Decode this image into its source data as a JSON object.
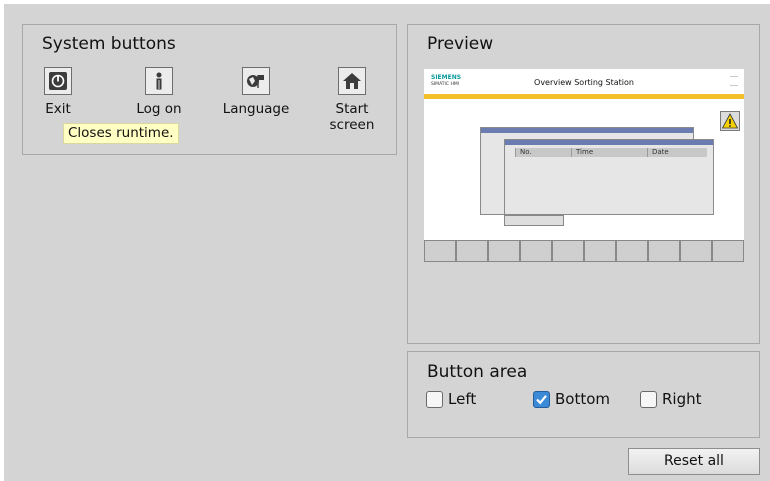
{
  "system_buttons": {
    "title": "System buttons",
    "items": [
      {
        "label": "Exit",
        "icon": "exit-icon"
      },
      {
        "label": "Log on",
        "icon": "user-icon"
      },
      {
        "label": "Language",
        "icon": "language-icon"
      },
      {
        "label": "Start screen",
        "icon": "home-icon"
      }
    ],
    "tooltip": "Closes runtime."
  },
  "preview": {
    "title": "Preview",
    "brand": "SIEMENS",
    "product": "SIMATIC HMI",
    "screen_title": "Overview Sorting Station",
    "columns": [
      "No.",
      "Time",
      "Date"
    ],
    "accent_color": "#f3c02c"
  },
  "button_area": {
    "title": "Button area",
    "options": [
      {
        "label": "Left",
        "checked": false
      },
      {
        "label": "Bottom",
        "checked": true
      },
      {
        "label": "Right",
        "checked": false
      }
    ]
  },
  "reset_label": "Reset all",
  "colors": {
    "checkbox_checked": "#3a8ad8",
    "tooltip_bg": "#ffffc4"
  }
}
